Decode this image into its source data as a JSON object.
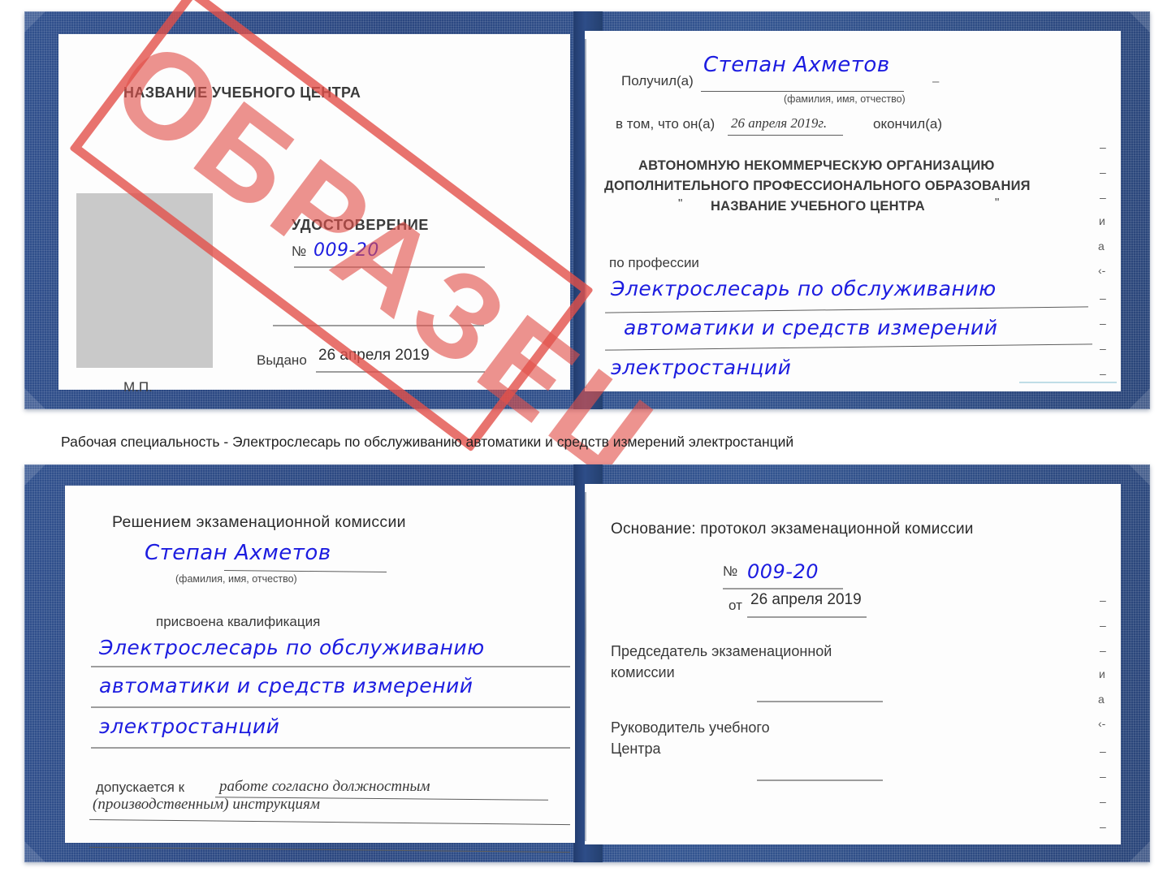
{
  "document": {
    "kind": "Удостоверение",
    "stamp_label": "ОБРАЗЕЦ",
    "stamp_color": "#e2504a",
    "cover_color": "#2e4d88",
    "ink_color": "#1c1ce0"
  },
  "caption": {
    "text": "Рабочая специальность - Электрослесарь по обслуживанию автоматики и средств измерений электростанций"
  },
  "cert_top": {
    "left_page": {
      "org_title": "НАЗВАНИЕ УЧЕБНОГО ЦЕНТРА",
      "doc_type": "УДОСТОВЕРЕНИЕ",
      "number_label": "№",
      "number_value": "009-20",
      "issued_label": "Выдано",
      "issued_value": "26 апреля 2019",
      "seal_label": "М.П.",
      "photo_placeholder": "photo-placeholder"
    },
    "right_page": {
      "received_label": "Получил(а)",
      "received_value": "Степан Ахметов",
      "received_hint": "(фамилия, имя, отчество)",
      "that_he_label": "в том, что он(а)",
      "that_he_value": "26 апреля 2019г.",
      "finished_label": "окончил(а)",
      "org_line1": "АВТОНОМНУЮ НЕКОММЕРЧЕСКУЮ ОРГАНИЗАЦИЮ",
      "org_line2": "ДОПОЛНИТЕЛЬНОГО ПРОФЕССИОНАЛЬНОГО ОБРАЗОВАНИЯ",
      "org_quote_open": "\"",
      "org_line3": "НАЗВАНИЕ УЧЕБНОГО ЦЕНТРА",
      "org_quote_close": "\"",
      "profession_label": "по профессии",
      "profession_line1": "Электрослесарь по обслуживанию",
      "profession_line2": "автоматики и средств измерений",
      "profession_line3": "электростанций"
    },
    "edge_glyphs": [
      "–",
      "–",
      "–",
      "и",
      "а",
      "‹-",
      "–",
      "–",
      "–",
      "–"
    ]
  },
  "cert_bottom": {
    "left_page": {
      "decision_title": "Решением экзаменационной комиссии",
      "name_value": "Степан Ахметов",
      "name_hint": "(фамилия, имя, отчество)",
      "qualification_label": "присвоена квалификация",
      "qualification_line1": "Электрослесарь по обслуживанию",
      "qualification_line2": "автоматики и средств измерений",
      "qualification_line3": "электростанций",
      "allowed_label": "допускается к",
      "allowed_value_line1": "работе согласно должностным",
      "allowed_value_line2": "(производственным) инструкциям"
    },
    "right_page": {
      "basis_label": "Основание: протокол экзаменационной комиссии",
      "number_label": "№",
      "number_value": "009-20",
      "date_label": "от",
      "date_value": "26 апреля 2019",
      "chairman_line1": "Председатель экзаменационной",
      "chairman_line2": "комиссии",
      "head_line1": "Руководитель учебного",
      "head_line2": "Центра"
    },
    "edge_glyphs": [
      "–",
      "–",
      "–",
      "и",
      "а",
      "‹-",
      "–",
      "–",
      "–",
      "–"
    ]
  }
}
